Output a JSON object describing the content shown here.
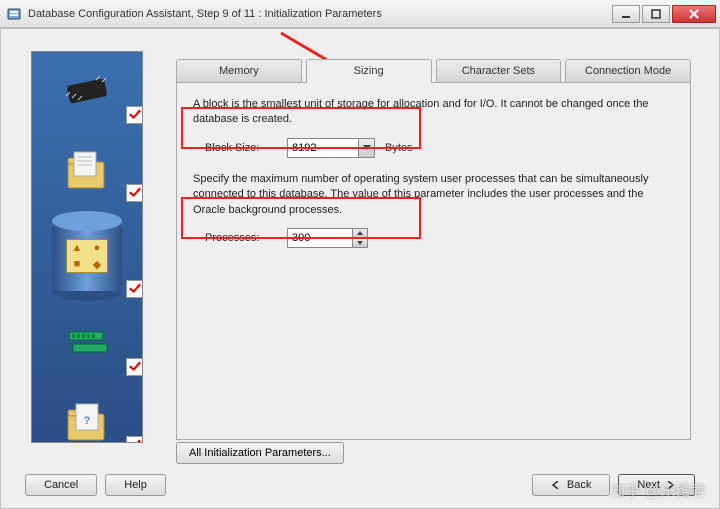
{
  "window": {
    "title": "Database Configuration Assistant, Step 9 of 11 : Initialization Parameters"
  },
  "tabs": {
    "memory": "Memory",
    "sizing": "Sizing",
    "charsets": "Character Sets",
    "connmode": "Connection Mode"
  },
  "sizing": {
    "block_desc": "A block is the smallest unit of storage for allocation and for I/O. It cannot be changed once the database is created.",
    "block_size_label": "Block Size:",
    "block_size_value": "8192",
    "block_size_units": "Bytes",
    "proc_desc": "Specify the maximum number of operating system user processes that can be simultaneously connected to this database. The value of this parameter includes the user processes and the Oracle background processes.",
    "processes_label": "Processes:",
    "processes_value": "300"
  },
  "buttons": {
    "all_params": "All Initialization Parameters...",
    "cancel": "Cancel",
    "help": "Help",
    "back": "Back",
    "next": "Next"
  },
  "watermark": "知乎 @乐维君"
}
